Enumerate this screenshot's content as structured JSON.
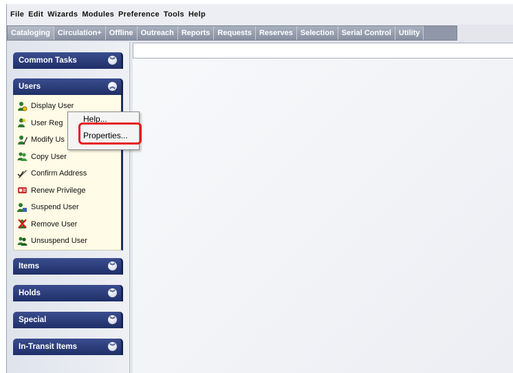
{
  "menubar": {
    "items": [
      "File",
      "Edit",
      "Wizards",
      "Modules",
      "Preference",
      "Tools",
      "Help"
    ]
  },
  "tabs": [
    "Cataloging",
    "Circulation+",
    "Offline",
    "Outreach",
    "Reports",
    "Requests",
    "Reserves",
    "Selection",
    "Serial Control",
    "Utility"
  ],
  "sidebar": {
    "common_tasks": "Common Tasks",
    "users": {
      "title": "Users",
      "tasks": [
        {
          "label": "Display User",
          "icon": "display-user-icon"
        },
        {
          "label": "User Reg",
          "icon": "user-registration-icon"
        },
        {
          "label": "Modify Us",
          "icon": "modify-user-icon"
        },
        {
          "label": "Copy User",
          "icon": "copy-user-icon"
        },
        {
          "label": "Confirm Address",
          "icon": "confirm-address-icon"
        },
        {
          "label": "Renew Privilege",
          "icon": "renew-privilege-icon"
        },
        {
          "label": "Suspend User",
          "icon": "suspend-user-icon"
        },
        {
          "label": "Remove User",
          "icon": "remove-user-icon"
        },
        {
          "label": "Unsuspend User",
          "icon": "unsuspend-user-icon"
        }
      ]
    },
    "items": "Items",
    "holds": "Holds",
    "special": "Special",
    "in_transit": "In-Transit Items"
  },
  "context_menu": {
    "help": "Help...",
    "properties": "Properties..."
  },
  "colors": {
    "highlight": "#e51a1a",
    "group_header": "#1f2f68",
    "task_panel": "#fffbe6"
  }
}
